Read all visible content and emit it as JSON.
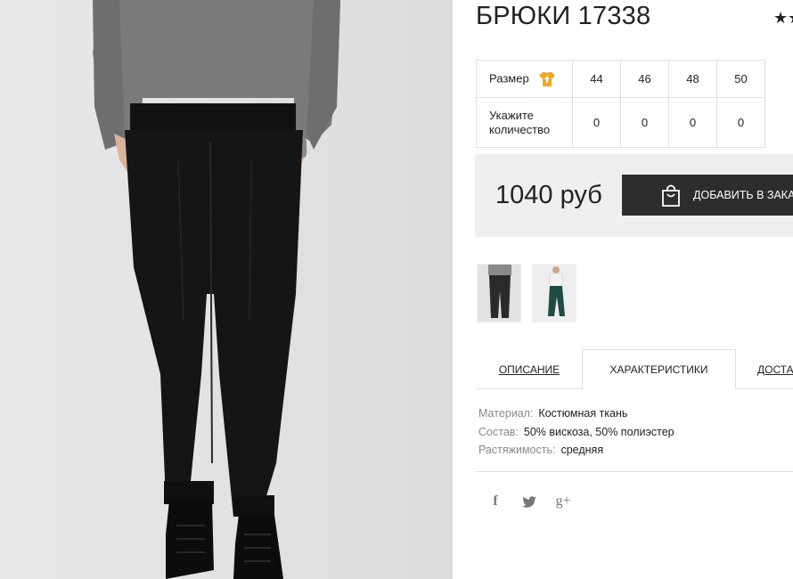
{
  "product": {
    "title": "БРЮКИ 17338",
    "rating_stars": "★★"
  },
  "sizes": {
    "size_label": "Размер",
    "values": [
      "44",
      "46",
      "48",
      "50"
    ],
    "quantity_label_line1": "Укажите",
    "quantity_label_line2": "количество",
    "quantities": [
      "0",
      "0",
      "0",
      "0"
    ]
  },
  "purchase": {
    "price": "1040 руб",
    "add_to_cart_label": "ДОБАВИТЬ В ЗАКАЗ"
  },
  "thumbnails": [
    {
      "name": "black-trousers-thumbnail",
      "color": "#222222"
    },
    {
      "name": "green-trousers-thumbnail",
      "color": "#1f4a45"
    }
  ],
  "tabs": [
    {
      "label": "ОПИСАНИЕ",
      "active": false
    },
    {
      "label": "ХАРАКТЕРИСТИКИ",
      "active": true
    },
    {
      "label": "ДОСТАВКА",
      "active": false
    }
  ],
  "characteristics": [
    {
      "key": "Материал:",
      "value": "Костюмная ткань"
    },
    {
      "key": "Состав:",
      "value": "50% вискоза, 50% полиэстер"
    },
    {
      "key": "Растяжимость:",
      "value": "средняя"
    }
  ],
  "social": {
    "facebook_glyph": "f",
    "twitter_glyph": "🐦",
    "googleplus_glyph": "g+"
  },
  "colors": {
    "button_bg": "#2d2d2d",
    "price_box_bg": "#efefef",
    "size_icon_accent": "#f5a623",
    "border": "#e0e0e0"
  }
}
